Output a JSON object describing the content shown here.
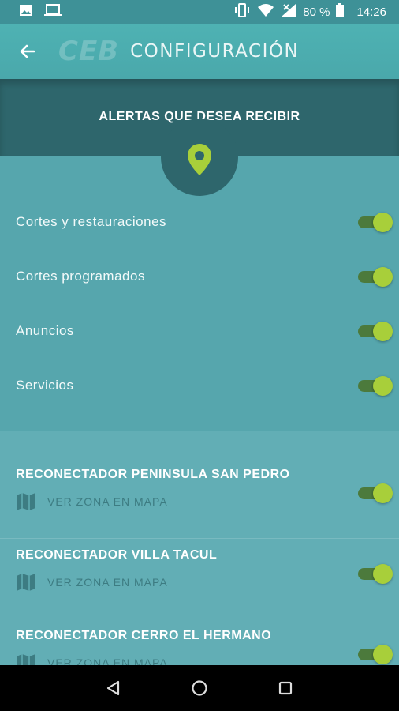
{
  "status_bar": {
    "battery_percent": "80 %",
    "time": "14:26",
    "icons": [
      "image-icon",
      "laptop-icon",
      "vibrate-icon",
      "wifi-icon",
      "signal-icon",
      "battery-icon"
    ]
  },
  "app_bar": {
    "logo_text": "CEB",
    "title": "CONFIGURACIÓN"
  },
  "alerts_header": {
    "title": "ALERTAS QUE DESEA RECIBIR",
    "icon": "location-pin-icon"
  },
  "alerts": [
    {
      "label": "Cortes y restauraciones",
      "enabled": true
    },
    {
      "label": "Cortes programados",
      "enabled": true
    },
    {
      "label": "Anuncios",
      "enabled": true
    },
    {
      "label": "Servicios",
      "enabled": true
    }
  ],
  "reconnectors": [
    {
      "title": "RECONECTADOR PENINSULA SAN PEDRO",
      "map_label": "VER ZONA EN MAPA",
      "enabled": true
    },
    {
      "title": "RECONECTADOR VILLA TACUL",
      "map_label": "VER ZONA EN MAPA",
      "enabled": true
    },
    {
      "title": "RECONECTADOR CERRO EL HERMANO",
      "map_label": "VER ZONA EN MAPA",
      "enabled": true
    }
  ],
  "colors": {
    "toggle_on_thumb": "#a8cf3a",
    "header_dark": "#2e666c",
    "background": "#56a6ad"
  }
}
